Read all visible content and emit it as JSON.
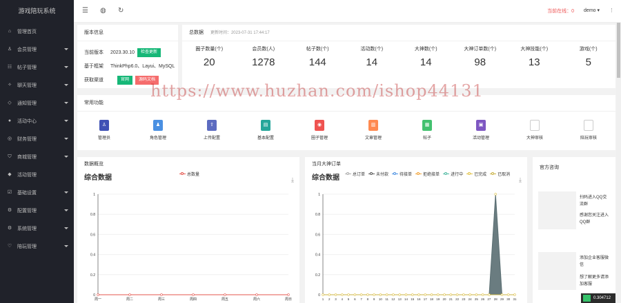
{
  "sidebar": {
    "logo": "游戏陪玩系统",
    "items": [
      {
        "label": "管理首页",
        "icon": "home-icon",
        "glyph": "⌂",
        "arrow": false
      },
      {
        "label": "会员管理",
        "icon": "user-icon",
        "glyph": "♙",
        "arrow": true
      },
      {
        "label": "帖子管理",
        "icon": "post-icon",
        "glyph": "☷",
        "arrow": true
      },
      {
        "label": "聊天管理",
        "icon": "chat-icon",
        "glyph": "✧",
        "arrow": true
      },
      {
        "label": "通知管理",
        "icon": "notice-icon",
        "glyph": "◇",
        "arrow": true
      },
      {
        "label": "活动中心",
        "icon": "activity-icon",
        "glyph": "●",
        "arrow": true
      },
      {
        "label": "财务管理",
        "icon": "finance-icon",
        "glyph": "◎",
        "arrow": true
      },
      {
        "label": "商城管理",
        "icon": "shop-icon",
        "glyph": "⛉",
        "arrow": true
      },
      {
        "label": "活动管理",
        "icon": "event-icon",
        "glyph": "◆",
        "arrow": false
      },
      {
        "label": "基础设置",
        "icon": "settings-icon",
        "glyph": "☑",
        "arrow": true
      },
      {
        "label": "配置管理",
        "icon": "config-icon",
        "glyph": "⚙",
        "arrow": true
      },
      {
        "label": "系统管理",
        "icon": "system-icon",
        "glyph": "⚙",
        "arrow": true
      },
      {
        "label": "陪玩管理",
        "icon": "escort-icon",
        "glyph": "♡",
        "arrow": true
      }
    ]
  },
  "header": {
    "online": "当前在线：0",
    "user": "demo ▾",
    "more": "⋮",
    "icons": {
      "menu": "☰",
      "globe": "◍",
      "refresh": "↻"
    }
  },
  "version": {
    "title": "版本信息",
    "rows": [
      {
        "key": "当前版本",
        "value": "2023.30.10",
        "button": "检查更新",
        "btn_color": "#16b777"
      },
      {
        "key": "基于框架",
        "value": "ThinkPhp6.0、Layui、MySQL"
      },
      {
        "key": "获取渠道",
        "value": "",
        "button": "官网",
        "btn_color": "#16b777",
        "button2": "源码文档",
        "btn2_color": "#f56c6c"
      }
    ]
  },
  "stats": {
    "title": "总数据",
    "updated": "更新时间：2023-07-31 17:44:17",
    "items": [
      {
        "label": "圈子数量(个)",
        "value": "20"
      },
      {
        "label": "会员数(人)",
        "value": "1278"
      },
      {
        "label": "帖子数(个)",
        "value": "144"
      },
      {
        "label": "活动数(个)",
        "value": "14"
      },
      {
        "label": "大神数(个)",
        "value": "14"
      },
      {
        "label": "大神订单数(个)",
        "value": "98"
      },
      {
        "label": "大神技能(个)",
        "value": "13"
      },
      {
        "label": "游戏(个)",
        "value": "5"
      }
    ]
  },
  "features": {
    "title": "常用功能",
    "items": [
      {
        "label": "管理员",
        "color": "#3f51b5",
        "icon": "admin-icon",
        "glyph": "♙"
      },
      {
        "label": "角色管理",
        "color": "#4a90e2",
        "icon": "role-icon",
        "glyph": "♟"
      },
      {
        "label": "上传配置",
        "color": "#5c6bc0",
        "icon": "upload-icon",
        "glyph": "⇪"
      },
      {
        "label": "基本配置",
        "color": "#26a69a",
        "icon": "basic-config-icon",
        "glyph": "▤"
      },
      {
        "label": "圈子管理",
        "color": "#ef5350",
        "icon": "circle-icon",
        "glyph": "◉"
      },
      {
        "label": "文章管理",
        "color": "#ff8a50",
        "icon": "article-icon",
        "glyph": "▥"
      },
      {
        "label": "帖子",
        "color": "#43c16f",
        "icon": "post-feature-icon",
        "glyph": "▦"
      },
      {
        "label": "活动管理",
        "color": "#7e57c2",
        "icon": "event-feature-icon",
        "glyph": "▣"
      },
      {
        "label": "大神审核",
        "color": "none",
        "icon": "broken-image-icon",
        "glyph": ""
      },
      {
        "label": "陪玩审核",
        "color": "none",
        "icon": "broken-image-icon",
        "glyph": ""
      }
    ]
  },
  "watermark": "https://www.huzhan.com/ishop44131",
  "chart1": {
    "section": "数据概览",
    "big_title": "综合数据",
    "download": "⤓"
  },
  "chart2": {
    "section": "当月大神订单",
    "big_title": "综合数据",
    "download": "⤓"
  },
  "right_card": {
    "title": "官方咨询",
    "items": [
      {
        "text": "扫码进入QQ交流群",
        "sub": "感谢您关注进入QQ群"
      },
      {
        "text": "添加企业客服微信",
        "sub": "想了解更多请添加客服"
      }
    ],
    "badge": "0.304712"
  },
  "chart_data": [
    {
      "type": "line",
      "title": "综合数据",
      "categories": [
        "周一",
        "周二",
        "周三",
        "周四",
        "周五",
        "周六",
        "周日"
      ],
      "series": [
        {
          "name": "总数量",
          "color": "#e4544c",
          "values": [
            0,
            0,
            0,
            0,
            0,
            0,
            0
          ]
        }
      ],
      "yticks": [
        "0",
        "0.2",
        "0.4",
        "0.6",
        "0.8",
        "1"
      ],
      "ylim": [
        0,
        1
      ],
      "legend": "top"
    },
    {
      "type": "area",
      "title": "综合数据",
      "categories": [
        "1",
        "2",
        "3",
        "4",
        "5",
        "6",
        "7",
        "8",
        "9",
        "10",
        "11",
        "12",
        "13",
        "14",
        "15",
        "16",
        "17",
        "18",
        "19",
        "20",
        "21",
        "22",
        "23",
        "24",
        "25",
        "26",
        "27",
        "28",
        "29",
        "30",
        "31"
      ],
      "legend_items": [
        {
          "name": "总订单",
          "color": "#aaaaaa"
        },
        {
          "name": "未付款",
          "color": "#555555"
        },
        {
          "name": "待接单",
          "color": "#4a90e2"
        },
        {
          "name": "拒绝接单",
          "color": "#f0a030"
        },
        {
          "name": "进行中",
          "color": "#4ab8a0"
        },
        {
          "name": "已完成",
          "color": "#e0c040"
        },
        {
          "name": "已取消",
          "color": "#c8b040"
        }
      ],
      "series": [
        {
          "name": "总订单",
          "color": "#5a6e72",
          "values": [
            0,
            0,
            0,
            0,
            0,
            0,
            0,
            0,
            0,
            0,
            0,
            0,
            0,
            0,
            0,
            0,
            0,
            0,
            0,
            0,
            0,
            0,
            0,
            0,
            0,
            0,
            0,
            1,
            0,
            0,
            0
          ]
        }
      ],
      "yticks": [
        "0",
        "0.2",
        "0.4",
        "0.6",
        "0.8",
        "1"
      ],
      "ylim": [
        0,
        1
      ],
      "legend": "top"
    }
  ]
}
